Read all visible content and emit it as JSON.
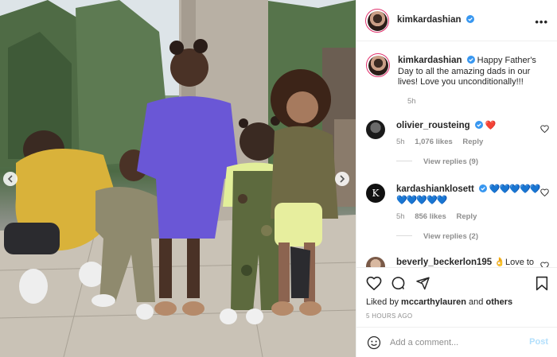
{
  "post": {
    "author": "kimkardashian",
    "verified": true,
    "more_icon": "more-horizontal-icon"
  },
  "caption": {
    "username": "kimkardashian",
    "text": "Happy Father's Day to all the amazing dads in our lives! Love you unconditionally!!!",
    "time": "5h"
  },
  "comments": [
    {
      "username": "olivier_rousteing",
      "text": "❤️",
      "time": "5h",
      "likes": "1,076 likes",
      "reply_label": "Reply",
      "view_replies": "View replies (9)"
    },
    {
      "username": "kardashianklosett",
      "text": "💙💙💙💙💙💙💙💙💙💙",
      "time": "5h",
      "likes": "856 likes",
      "reply_label": "Reply",
      "view_replies": "View replies (2)"
    },
    {
      "username": "beverly_beckerlon195",
      "text": "👌Love to"
    }
  ],
  "actions": {
    "like_icon": "heart-icon",
    "comment_icon": "comment-icon",
    "share_icon": "share-icon",
    "save_icon": "bookmark-icon"
  },
  "likes_summary": {
    "prefix": "Liked by",
    "user": "mccarthylauren",
    "joiner": "and",
    "others": "others"
  },
  "timestamp": "5 HOURS AGO",
  "add_comment": {
    "placeholder": "Add a comment...",
    "post_label": "Post"
  },
  "colors": {
    "verified_blue": "#3897f0",
    "post_button_disabled": "#b2dffc",
    "secondary_text": "#8e8e8e"
  }
}
